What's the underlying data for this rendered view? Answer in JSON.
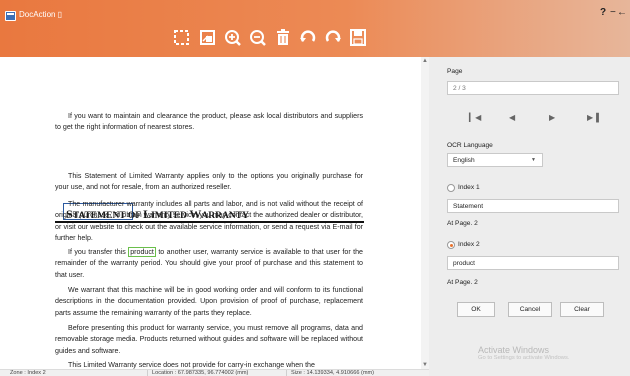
{
  "window": {
    "title": "DocAction ▯",
    "help": "?",
    "minimize": "−",
    "close": "←"
  },
  "toolbar": {
    "icons": [
      "crop-icon",
      "fit-page-icon",
      "zoom-in-icon",
      "zoom-out-icon",
      "delete-icon",
      "rotate-left-icon",
      "rotate-right-icon",
      "save-icon"
    ]
  },
  "document": {
    "p1": "If you want to maintain and clearance the product, please ask local distributors and suppliers to get the right information of nearest stores.",
    "heading_first": "S",
    "heading_first_rest": "TATEMENT",
    "heading_of": " OF ",
    "heading_l": "L",
    "heading_l_rest": "IMITED ",
    "heading_w": "W",
    "heading_w_rest": "ARRANTY",
    "p2": "This Statement of Limited Warranty applies only to the options you originally purchase for your use, and not for resale, from an authorized reseller.",
    "p3": "The manufacturer warranty includes all parts and labor, and is not valid without the receipt of original purchase. To obtain warranty service, you may contact the authorized dealer or distributor, or visit our website to check out the available service information, or send a request via E-mail for further help.",
    "p4_pre": "If you transfer this ",
    "p4_hl": "product",
    "p4_post": " to another user, warranty service is available to that user for the remainder of the warranty period. You should give your proof of purchase and this statement to that user.",
    "p5": "We warrant that this machine will be in good working order and will conform to its functional descriptions in the documentation provided. Upon provision of proof of purchase, replacement parts assume the remaining warranty of the parts they replace.",
    "p6": "Before presenting this product for warranty service, you must remove all programs, data and removable storage media. Products returned without guides and software will be replaced without guides and software.",
    "p7": "This Limited Warranty service does not provide for carry-in exchange when the"
  },
  "status": {
    "zone": "Zone : Index 2",
    "location": "Location : 67.987335, 96.774002 (mm)",
    "size": "Size : 14.139334, 4.910666 (mm)"
  },
  "panel": {
    "page_label": "Page",
    "page_value": "2 / 3",
    "nav": [
      "first-page-icon",
      "prev-page-icon",
      "next-page-icon",
      "last-page-icon"
    ],
    "ocr_label": "OCR Language",
    "ocr_value": "English",
    "index1_label": "Index 1",
    "index1_value": "Statement",
    "index1_page": "At Page. 2",
    "index2_label": "Index 2",
    "index2_value": "product",
    "index2_page": "At Page. 2",
    "ok": "OK",
    "cancel": "Cancel",
    "clear": "Clear",
    "index2_selected": true
  },
  "watermark": {
    "line1": "Activate Windows",
    "line2": "Go to Settings to activate Windows."
  },
  "colors": {
    "accent": "#e9783f",
    "heading_box": "#2c5aa0",
    "highlight": "#6abf4b"
  }
}
